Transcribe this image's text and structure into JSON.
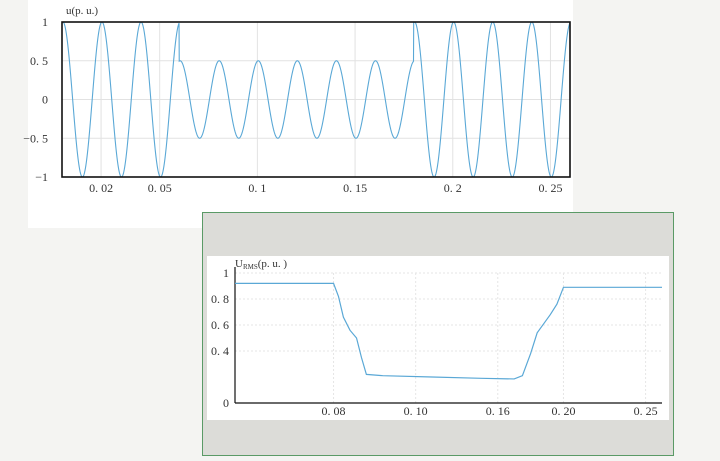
{
  "chart_data": [
    {
      "type": "line",
      "ylabel": "u(p. u.)",
      "xlim": [
        0.0,
        0.26
      ],
      "ylim": [
        -1,
        1
      ],
      "x_ticks": [
        "0. 02",
        "0. 05",
        "0. 1",
        "0. 15",
        "0. 2",
        "0. 25"
      ],
      "x_tick_values": [
        0.02,
        0.05,
        0.1,
        0.15,
        0.2,
        0.25
      ],
      "y_ticks": [
        "1",
        "0. 5",
        "0",
        "−0. 5",
        "−1"
      ],
      "y_tick_values": [
        1,
        0.5,
        0,
        -0.5,
        -1
      ],
      "grid": true,
      "series_color": "#5aa8d6",
      "segments": [
        {
          "x_start": 0.0,
          "x_end": 0.06,
          "amplitude": 1.0
        },
        {
          "x_start": 0.06,
          "x_end": 0.18,
          "amplitude": 0.5
        },
        {
          "x_start": 0.18,
          "x_end": 0.26,
          "amplitude": 1.0
        }
      ],
      "frequency_hz": 50
    },
    {
      "type": "line",
      "ylabel": "U",
      "ylabel_sub": "RMS",
      "ylabel_unit": "(p. u. )",
      "xlim": [
        0.0,
        0.26
      ],
      "ylim": [
        0,
        1
      ],
      "x_ticks": [
        "0. 08",
        "0. 10",
        "0. 16",
        "0. 20",
        "0. 25"
      ],
      "x_tick_values": [
        0.06,
        0.11,
        0.16,
        0.2,
        0.25
      ],
      "y_ticks": [
        "1",
        "0. 8",
        "0. 6",
        "0. 4",
        "0"
      ],
      "y_tick_values": [
        1,
        0.8,
        0.6,
        0.4,
        0
      ],
      "grid": true,
      "series_color": "#5aa8d6",
      "x": [
        0.0,
        0.05,
        0.06,
        0.063,
        0.066,
        0.07,
        0.074,
        0.077,
        0.08,
        0.09,
        0.12,
        0.15,
        0.17,
        0.175,
        0.18,
        0.184,
        0.188,
        0.192,
        0.196,
        0.2,
        0.26
      ],
      "y": [
        0.92,
        0.92,
        0.92,
        0.82,
        0.66,
        0.56,
        0.5,
        0.35,
        0.22,
        0.21,
        0.2,
        0.19,
        0.185,
        0.21,
        0.38,
        0.54,
        0.61,
        0.68,
        0.76,
        0.89,
        0.89
      ]
    }
  ]
}
